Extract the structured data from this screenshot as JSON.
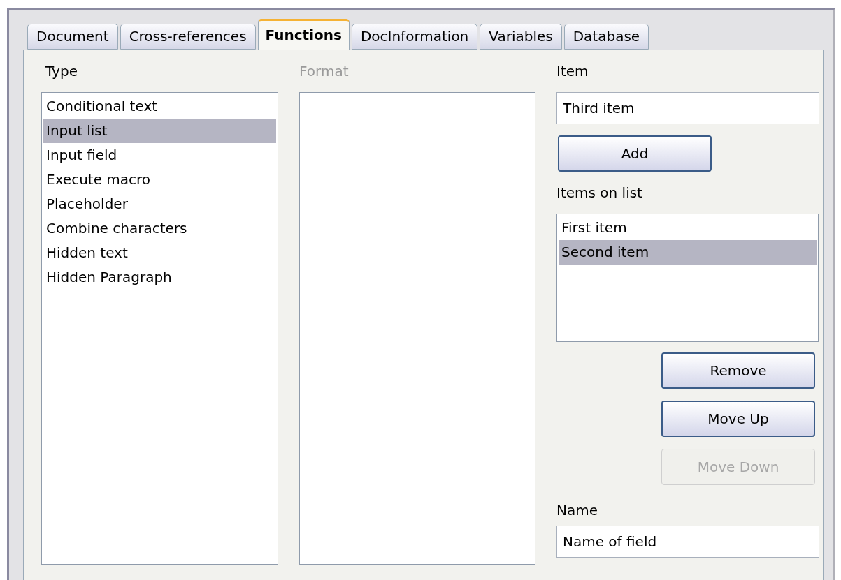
{
  "tabs": [
    {
      "label": "Document",
      "selected": false
    },
    {
      "label": "Cross-references",
      "selected": false
    },
    {
      "label": "Functions",
      "selected": true
    },
    {
      "label": "DocInformation",
      "selected": false
    },
    {
      "label": "Variables",
      "selected": false
    },
    {
      "label": "Database",
      "selected": false
    }
  ],
  "type": {
    "label": "Type",
    "items": [
      {
        "label": "Conditional text",
        "selected": false
      },
      {
        "label": "Input list",
        "selected": true
      },
      {
        "label": "Input field",
        "selected": false
      },
      {
        "label": "Execute macro",
        "selected": false
      },
      {
        "label": "Placeholder",
        "selected": false
      },
      {
        "label": "Combine characters",
        "selected": false
      },
      {
        "label": "Hidden text",
        "selected": false
      },
      {
        "label": "Hidden Paragraph",
        "selected": false
      }
    ]
  },
  "format": {
    "label": "Format",
    "disabled": true
  },
  "item": {
    "label": "Item",
    "value": "Third item"
  },
  "add_button": {
    "label": "Add",
    "disabled": false
  },
  "items_on_list": {
    "label": "Items on list",
    "items": [
      {
        "label": "First item",
        "selected": false
      },
      {
        "label": "Second item",
        "selected": true
      }
    ]
  },
  "list_buttons": [
    {
      "label": "Remove",
      "disabled": false
    },
    {
      "label": "Move Up",
      "disabled": false
    },
    {
      "label": "Move Down",
      "disabled": true
    }
  ],
  "name": {
    "label": "Name",
    "value": "Name of field"
  }
}
